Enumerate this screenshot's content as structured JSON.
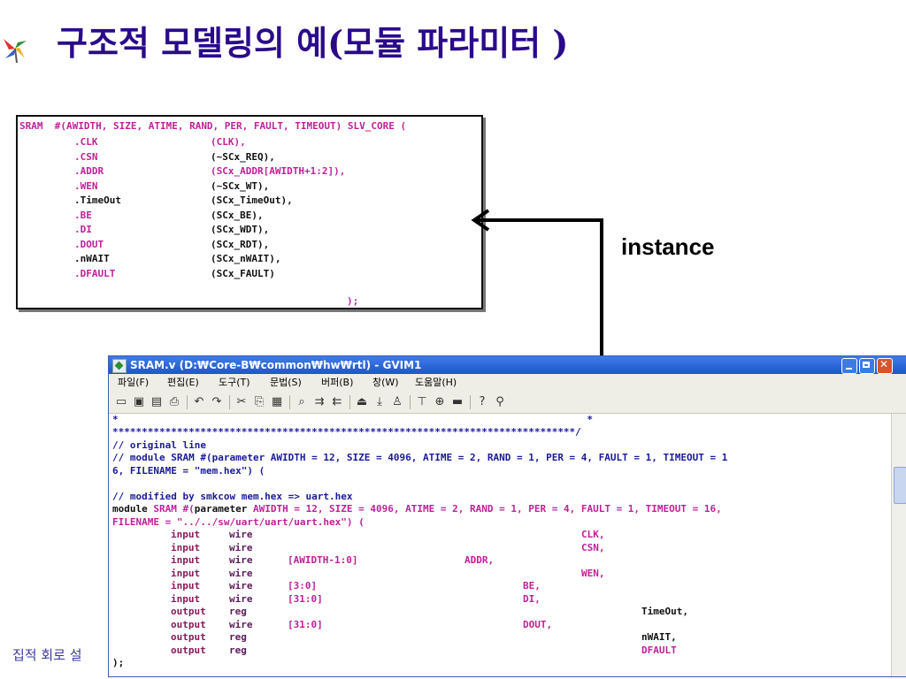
{
  "slide": {
    "title_main": "구조적 모델링의 예",
    "title_paren": "(모듈 파라미터 )",
    "instance_label": "instance",
    "footer": "집적 회로 설"
  },
  "instance_code": {
    "header_kw": "SRAM",
    "header_rest": "#(AWIDTH, SIZE, ATIME, RAND, PER, FAULT, TIMEOUT) SLV_CORE (",
    "ports": [
      {
        "port": ".CLK",
        "conn": "(CLK),"
      },
      {
        "port": ".CSN",
        "conn": "(~SCx_REQ),"
      },
      {
        "port": ".ADDR",
        "conn": "(SCx_ADDR[AWIDTH+1:2]),"
      },
      {
        "port": ".WEN",
        "conn": "(~SCx_WT),"
      },
      {
        "port": ".TimeOut",
        "conn": "(SCx_TimeOut),"
      },
      {
        "port": ".BE",
        "conn": "(SCx_BE),"
      },
      {
        "port": ".DI",
        "conn": "(SCx_WDT),"
      },
      {
        "port": ".DOUT",
        "conn": "(SCx_RDT),"
      },
      {
        "port": ".nWAIT",
        "conn": "(SCx_nWAIT),"
      },
      {
        "port": ".DFAULT",
        "conn": "(SCx_FAULT)"
      }
    ],
    "closing": ");"
  },
  "window": {
    "title": "SRAM.v (D:₩Core-B₩common₩hw₩rtl) - GVIM1",
    "menu": [
      "파일(F)",
      "편집(E)",
      "도구(T)",
      "문법(S)",
      "버퍼(B)",
      "창(W)",
      "도움말(H)"
    ],
    "toolbar_icons": [
      "open-icon",
      "save-icon",
      "save-all-icon",
      "print-icon",
      "undo-icon",
      "redo-icon",
      "cut-icon",
      "copy-icon",
      "paste-icon",
      "find-icon",
      "find-next-icon",
      "find-prev-icon",
      "load-session-icon",
      "save-session-icon",
      "run-script-icon",
      "make-icon",
      "shell-icon",
      "tags-icon",
      "help-icon",
      "find-help-icon"
    ]
  },
  "editor": {
    "line1": "*                                                                                *",
    "line2": "*******************************************************************************/",
    "line3": "// original line",
    "line4": "// module SRAM #(parameter AWIDTH = 12, SIZE = 4096, ATIME = 2, RAND = 1, PER = 4, FAULT = 1, TIMEOUT = 1",
    "line5": "6, FILENAME = \"mem.hex\") (",
    "line6": "// modified by smkcow mem.hex => uart.hex",
    "module_kw": "module",
    "line7a": " SRAM #(",
    "param_kw": "parameter",
    "line7b": " AWIDTH = 12, SIZE = 4096, ATIME = 2, RAND = 1, PER = 4, FAULT = 1, TIMEOUT = 16,",
    "line8": "FILENAME = \"../../sw/uart/uart/uart.hex\") (",
    "ports": [
      {
        "dir": "input",
        "type": "wire",
        "range": "",
        "name": "CLK,"
      },
      {
        "dir": "input",
        "type": "wire",
        "range": "",
        "name": "CSN,"
      },
      {
        "dir": "input",
        "type": "wire",
        "range": "[AWIDTH-1:0]",
        "name": "ADDR,"
      },
      {
        "dir": "input",
        "type": "wire",
        "range": "",
        "name": "WEN,"
      },
      {
        "dir": "input",
        "type": "wire",
        "range": "[3:0]",
        "name": "BE,"
      },
      {
        "dir": "input",
        "type": "wire",
        "range": "[31:0]",
        "name": "DI,"
      },
      {
        "dir": "output",
        "type": "reg",
        "range": "",
        "name": "TimeOut,"
      },
      {
        "dir": "output",
        "type": "wire",
        "range": "[31:0]",
        "name": "DOUT,"
      },
      {
        "dir": "output",
        "type": "reg",
        "range": "",
        "name": "nWAIT,"
      },
      {
        "dir": "output",
        "type": "reg",
        "range": "",
        "name": "DFAULT"
      }
    ],
    "closing": ");"
  }
}
